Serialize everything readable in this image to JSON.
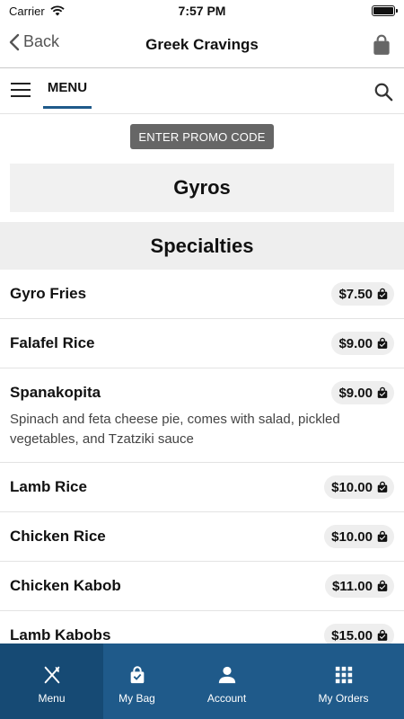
{
  "status_bar": {
    "carrier": "Carrier",
    "time": "7:57 PM"
  },
  "nav": {
    "back_label": "Back",
    "title": "Greek Cravings"
  },
  "menu_bar": {
    "tab_label": "MENU"
  },
  "promo": {
    "label": "ENTER PROMO CODE"
  },
  "category": {
    "title": "Gyros"
  },
  "section": {
    "title": "Specialties"
  },
  "items": [
    {
      "name": "Gyro Fries",
      "price": "$7.50",
      "description": ""
    },
    {
      "name": "Falafel Rice",
      "price": "$9.00",
      "description": ""
    },
    {
      "name": "Spanakopita",
      "price": "$9.00",
      "description": "Spinach and feta cheese pie, comes with salad, pickled vegetables, and Tzatziki sauce"
    },
    {
      "name": "Lamb Rice",
      "price": "$10.00",
      "description": ""
    },
    {
      "name": "Chicken Rice",
      "price": "$10.00",
      "description": ""
    },
    {
      "name": "Chicken Kabob",
      "price": "$11.00",
      "description": ""
    },
    {
      "name": "Lamb Kabobs",
      "price": "$15.00",
      "description": ""
    }
  ],
  "tab_bar": {
    "tabs": [
      {
        "label": "Menu",
        "icon": "fork-knife-icon",
        "active": true
      },
      {
        "label": "My Bag",
        "icon": "bag-icon",
        "active": false
      },
      {
        "label": "Account",
        "icon": "person-icon",
        "active": false
      },
      {
        "label": "My Orders",
        "icon": "grid-icon",
        "active": false
      }
    ]
  },
  "colors": {
    "primary": "#1f5a8a",
    "primary_active": "#164a74",
    "promo_bg": "#666666",
    "pill_bg": "#eeeeee"
  }
}
